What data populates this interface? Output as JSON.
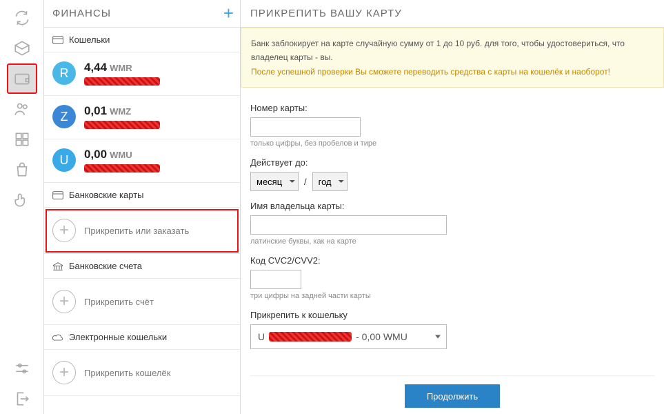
{
  "sidebar": {
    "title": "ФИНАНСЫ",
    "sections": {
      "wallets": "Кошельки",
      "cards": "Банковские карты",
      "accounts": "Банковские счета",
      "ewallets": "Электронные кошельки"
    },
    "wallets": [
      {
        "letter": "R",
        "amount": "4,44",
        "currency": "WMR",
        "badgeClass": "purse-R"
      },
      {
        "letter": "Z",
        "amount": "0,01",
        "currency": "WMZ",
        "badgeClass": "purse-Z"
      },
      {
        "letter": "U",
        "amount": "0,00",
        "currency": "WMU",
        "badgeClass": "purse-U"
      }
    ],
    "actions": {
      "attachOrOrder": "Прикрепить или заказать",
      "attachAccount": "Прикрепить счёт",
      "attachWallet": "Прикрепить кошелёк"
    }
  },
  "main": {
    "title": "ПРИКРЕПИТЬ ВАШУ КАРТУ",
    "notice_line1": "Банк заблокирует на карте случайную сумму от 1 до 10 руб. для того, чтобы удостовериться, что владелец карты - вы.",
    "notice_line2": "После успешной проверки Вы сможете переводить средства с карты на кошелёк и наоборот!",
    "form": {
      "card_number_label": "Номер карты:",
      "card_number_hint": "только цифры, без пробелов и тире",
      "expires_label": "Действует до:",
      "month_placeholder": "месяц",
      "year_placeholder": "год",
      "slash": "/",
      "holder_label": "Имя владельца карты:",
      "holder_hint": "латинские буквы, как на карте",
      "cvc_label": "Код CVC2/CVV2:",
      "cvc_hint": "три цифры на задней части карты",
      "attach_label": "Прикрепить к кошельку",
      "attach_prefix": "U",
      "attach_suffix": "- 0,00 WMU",
      "submit": "Продолжить"
    }
  }
}
